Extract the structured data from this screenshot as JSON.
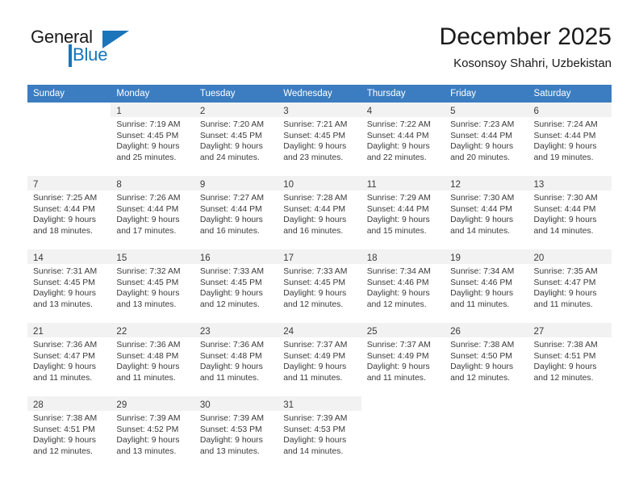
{
  "brand": {
    "name_part1": "General",
    "name_part2": "Blue",
    "accent_color": "#1b75bb",
    "logo_icon": "triangle-flag-icon"
  },
  "header": {
    "title": "December 2025",
    "subtitle": "Kosonsoy Shahri, Uzbekistan"
  },
  "calendar": {
    "header_bg": "#3b7dc0",
    "weekday_headers": [
      "Sunday",
      "Monday",
      "Tuesday",
      "Wednesday",
      "Thursday",
      "Friday",
      "Saturday"
    ],
    "weeks": [
      [
        {
          "day": "",
          "lines": []
        },
        {
          "day": "1",
          "lines": [
            "Sunrise: 7:19 AM",
            "Sunset: 4:45 PM",
            "Daylight: 9 hours",
            "and 25 minutes."
          ]
        },
        {
          "day": "2",
          "lines": [
            "Sunrise: 7:20 AM",
            "Sunset: 4:45 PM",
            "Daylight: 9 hours",
            "and 24 minutes."
          ]
        },
        {
          "day": "3",
          "lines": [
            "Sunrise: 7:21 AM",
            "Sunset: 4:45 PM",
            "Daylight: 9 hours",
            "and 23 minutes."
          ]
        },
        {
          "day": "4",
          "lines": [
            "Sunrise: 7:22 AM",
            "Sunset: 4:44 PM",
            "Daylight: 9 hours",
            "and 22 minutes."
          ]
        },
        {
          "day": "5",
          "lines": [
            "Sunrise: 7:23 AM",
            "Sunset: 4:44 PM",
            "Daylight: 9 hours",
            "and 20 minutes."
          ]
        },
        {
          "day": "6",
          "lines": [
            "Sunrise: 7:24 AM",
            "Sunset: 4:44 PM",
            "Daylight: 9 hours",
            "and 19 minutes."
          ]
        }
      ],
      [
        {
          "day": "7",
          "lines": [
            "Sunrise: 7:25 AM",
            "Sunset: 4:44 PM",
            "Daylight: 9 hours",
            "and 18 minutes."
          ]
        },
        {
          "day": "8",
          "lines": [
            "Sunrise: 7:26 AM",
            "Sunset: 4:44 PM",
            "Daylight: 9 hours",
            "and 17 minutes."
          ]
        },
        {
          "day": "9",
          "lines": [
            "Sunrise: 7:27 AM",
            "Sunset: 4:44 PM",
            "Daylight: 9 hours",
            "and 16 minutes."
          ]
        },
        {
          "day": "10",
          "lines": [
            "Sunrise: 7:28 AM",
            "Sunset: 4:44 PM",
            "Daylight: 9 hours",
            "and 16 minutes."
          ]
        },
        {
          "day": "11",
          "lines": [
            "Sunrise: 7:29 AM",
            "Sunset: 4:44 PM",
            "Daylight: 9 hours",
            "and 15 minutes."
          ]
        },
        {
          "day": "12",
          "lines": [
            "Sunrise: 7:30 AM",
            "Sunset: 4:44 PM",
            "Daylight: 9 hours",
            "and 14 minutes."
          ]
        },
        {
          "day": "13",
          "lines": [
            "Sunrise: 7:30 AM",
            "Sunset: 4:44 PM",
            "Daylight: 9 hours",
            "and 14 minutes."
          ]
        }
      ],
      [
        {
          "day": "14",
          "lines": [
            "Sunrise: 7:31 AM",
            "Sunset: 4:45 PM",
            "Daylight: 9 hours",
            "and 13 minutes."
          ]
        },
        {
          "day": "15",
          "lines": [
            "Sunrise: 7:32 AM",
            "Sunset: 4:45 PM",
            "Daylight: 9 hours",
            "and 13 minutes."
          ]
        },
        {
          "day": "16",
          "lines": [
            "Sunrise: 7:33 AM",
            "Sunset: 4:45 PM",
            "Daylight: 9 hours",
            "and 12 minutes."
          ]
        },
        {
          "day": "17",
          "lines": [
            "Sunrise: 7:33 AM",
            "Sunset: 4:45 PM",
            "Daylight: 9 hours",
            "and 12 minutes."
          ]
        },
        {
          "day": "18",
          "lines": [
            "Sunrise: 7:34 AM",
            "Sunset: 4:46 PM",
            "Daylight: 9 hours",
            "and 12 minutes."
          ]
        },
        {
          "day": "19",
          "lines": [
            "Sunrise: 7:34 AM",
            "Sunset: 4:46 PM",
            "Daylight: 9 hours",
            "and 11 minutes."
          ]
        },
        {
          "day": "20",
          "lines": [
            "Sunrise: 7:35 AM",
            "Sunset: 4:47 PM",
            "Daylight: 9 hours",
            "and 11 minutes."
          ]
        }
      ],
      [
        {
          "day": "21",
          "lines": [
            "Sunrise: 7:36 AM",
            "Sunset: 4:47 PM",
            "Daylight: 9 hours",
            "and 11 minutes."
          ]
        },
        {
          "day": "22",
          "lines": [
            "Sunrise: 7:36 AM",
            "Sunset: 4:48 PM",
            "Daylight: 9 hours",
            "and 11 minutes."
          ]
        },
        {
          "day": "23",
          "lines": [
            "Sunrise: 7:36 AM",
            "Sunset: 4:48 PM",
            "Daylight: 9 hours",
            "and 11 minutes."
          ]
        },
        {
          "day": "24",
          "lines": [
            "Sunrise: 7:37 AM",
            "Sunset: 4:49 PM",
            "Daylight: 9 hours",
            "and 11 minutes."
          ]
        },
        {
          "day": "25",
          "lines": [
            "Sunrise: 7:37 AM",
            "Sunset: 4:49 PM",
            "Daylight: 9 hours",
            "and 11 minutes."
          ]
        },
        {
          "day": "26",
          "lines": [
            "Sunrise: 7:38 AM",
            "Sunset: 4:50 PM",
            "Daylight: 9 hours",
            "and 12 minutes."
          ]
        },
        {
          "day": "27",
          "lines": [
            "Sunrise: 7:38 AM",
            "Sunset: 4:51 PM",
            "Daylight: 9 hours",
            "and 12 minutes."
          ]
        }
      ],
      [
        {
          "day": "28",
          "lines": [
            "Sunrise: 7:38 AM",
            "Sunset: 4:51 PM",
            "Daylight: 9 hours",
            "and 12 minutes."
          ]
        },
        {
          "day": "29",
          "lines": [
            "Sunrise: 7:39 AM",
            "Sunset: 4:52 PM",
            "Daylight: 9 hours",
            "and 13 minutes."
          ]
        },
        {
          "day": "30",
          "lines": [
            "Sunrise: 7:39 AM",
            "Sunset: 4:53 PM",
            "Daylight: 9 hours",
            "and 13 minutes."
          ]
        },
        {
          "day": "31",
          "lines": [
            "Sunrise: 7:39 AM",
            "Sunset: 4:53 PM",
            "Daylight: 9 hours",
            "and 14 minutes."
          ]
        },
        {
          "day": "",
          "lines": []
        },
        {
          "day": "",
          "lines": []
        },
        {
          "day": "",
          "lines": []
        }
      ]
    ]
  }
}
